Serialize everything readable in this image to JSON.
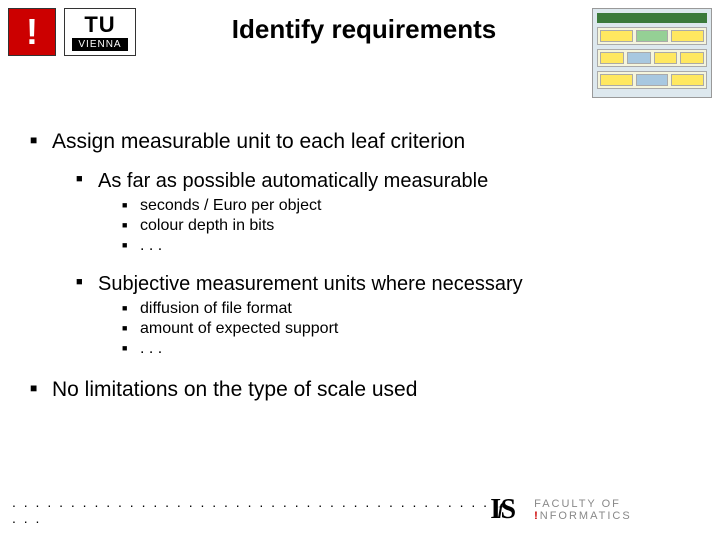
{
  "header": {
    "logo_red": "!",
    "logo_tu_top": "TU",
    "logo_tu_bottom": "VIENNA",
    "title": "Identify requirements"
  },
  "content": {
    "b1": "Assign measurable unit to each leaf criterion",
    "sub": {
      "s1": "As far as possible automatically measurable",
      "s1_items": {
        "a": "seconds / Euro per object",
        "b": "colour depth in bits",
        "c": ". . ."
      },
      "s2": "Subjective measurement units where necessary",
      "s2_items": {
        "a": "diffusion of file format",
        "b": "amount of expected support",
        "c": ". . ."
      }
    },
    "b2": "No limitations on the type of scale used"
  },
  "footer": {
    "dots": ". . . . . . . . . . . . . . . . . . . . . . . . . . . . . . . . . . . . . . . . . . . .",
    "ifs_i": "I",
    "ifs_f": "f",
    "ifs_s": "S",
    "faculty_prefix": "FACULTY OF ",
    "faculty_excl": "!",
    "faculty_suffix": "NFORMATICS"
  }
}
